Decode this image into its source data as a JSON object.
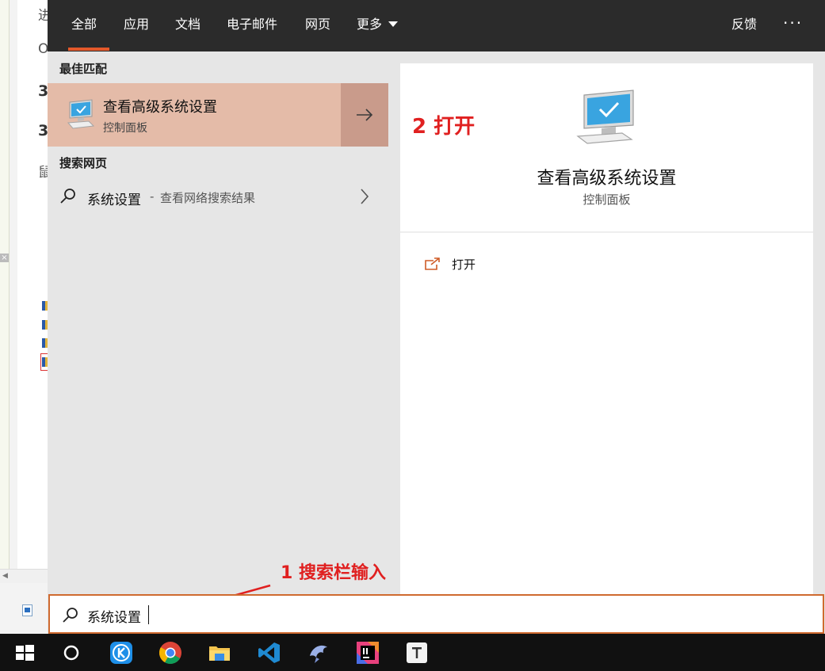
{
  "background_window": {
    "fragments": [
      "进",
      "O",
      "3",
      "3",
      "鼠"
    ],
    "close_glyph": "×"
  },
  "nav": {
    "tabs": [
      {
        "label": "全部",
        "active": true
      },
      {
        "label": "应用"
      },
      {
        "label": "文档"
      },
      {
        "label": "电子邮件"
      },
      {
        "label": "网页"
      },
      {
        "label": "更多"
      }
    ],
    "feedback": "反馈",
    "overflow": "···"
  },
  "results": {
    "best_match_heading": "最佳匹配",
    "best_match": {
      "title": "查看高级系统设置",
      "subtitle": "控制面板",
      "icon": "computer-monitor-icon"
    },
    "web_heading": "搜索网页",
    "web_result": {
      "query": "系统设置",
      "separator": "-",
      "description": "查看网络搜索结果"
    }
  },
  "preview": {
    "title": "查看高级系统设置",
    "subtitle": "控制面板",
    "actions": [
      {
        "label": "打开",
        "icon": "open-external-icon"
      }
    ]
  },
  "annotations": {
    "step2": "2 打开",
    "step1": "1 搜索栏输入"
  },
  "search": {
    "value": "系统设置"
  },
  "taskbar": {
    "icons": [
      "windows-start-icon",
      "cortana-circle-icon",
      "k-app-icon",
      "chrome-icon",
      "file-explorer-icon",
      "vscode-icon",
      "dolphin-app-icon",
      "intellij-icon",
      "typora-icon"
    ]
  },
  "colors": {
    "accent": "#e4582a",
    "highlight": "#e4bba8",
    "annotation_red": "#e02020",
    "nav_bg": "#2b2b2b",
    "search_border": "#cf6a2f"
  }
}
